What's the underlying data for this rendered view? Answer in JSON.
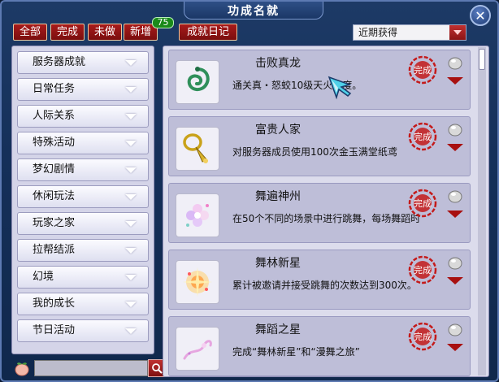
{
  "window": {
    "title": "功成名就",
    "close_label": "✕"
  },
  "filters": [
    {
      "label": "全部"
    },
    {
      "label": "完成"
    },
    {
      "label": "未做"
    },
    {
      "label": "新增"
    },
    {
      "label": "成就日记"
    }
  ],
  "new_badge": "75",
  "sort": {
    "selected": "近期获得"
  },
  "sidebar": {
    "items": [
      {
        "label": "服务器成就"
      },
      {
        "label": "日常任务"
      },
      {
        "label": "人际关系"
      },
      {
        "label": "特殊活动"
      },
      {
        "label": "梦幻剧情"
      },
      {
        "label": "休闲玩法"
      },
      {
        "label": "玩家之家"
      },
      {
        "label": "拉帮结派"
      },
      {
        "label": "幻境"
      },
      {
        "label": "我的成长"
      },
      {
        "label": "节日活动"
      }
    ]
  },
  "search": {
    "value": "",
    "placeholder": ""
  },
  "achievements": [
    {
      "title": "击败真龙",
      "desc": "通关真・怒蛟10级天火难度。",
      "icon": "dragon-icon",
      "seal": "完成"
    },
    {
      "title": "富贵人家",
      "desc": "对服务器成员使用100次金玉满堂纸鸢",
      "icon": "golden-trumpet-icon",
      "seal": "完成"
    },
    {
      "title": "舞遍神州",
      "desc": "在50个不同的场景中进行跳舞，每场舞蹈时",
      "icon": "flower-icon",
      "seal": "完成"
    },
    {
      "title": "舞林新星",
      "desc": "累计被邀请并接受跳舞的次数达到300次。",
      "icon": "sparkle-icon",
      "seal": "完成"
    },
    {
      "title": "舞蹈之星",
      "desc": "完成“舞林新星”和“漫舞之旅”",
      "icon": "ribbon-icon",
      "seal": "完成"
    }
  ],
  "colors": {
    "accent_red": "#a81b1b",
    "window_blue": "#15305a",
    "panel_lavender": "#dcdcec",
    "badge_green": "#1a8a1a"
  }
}
